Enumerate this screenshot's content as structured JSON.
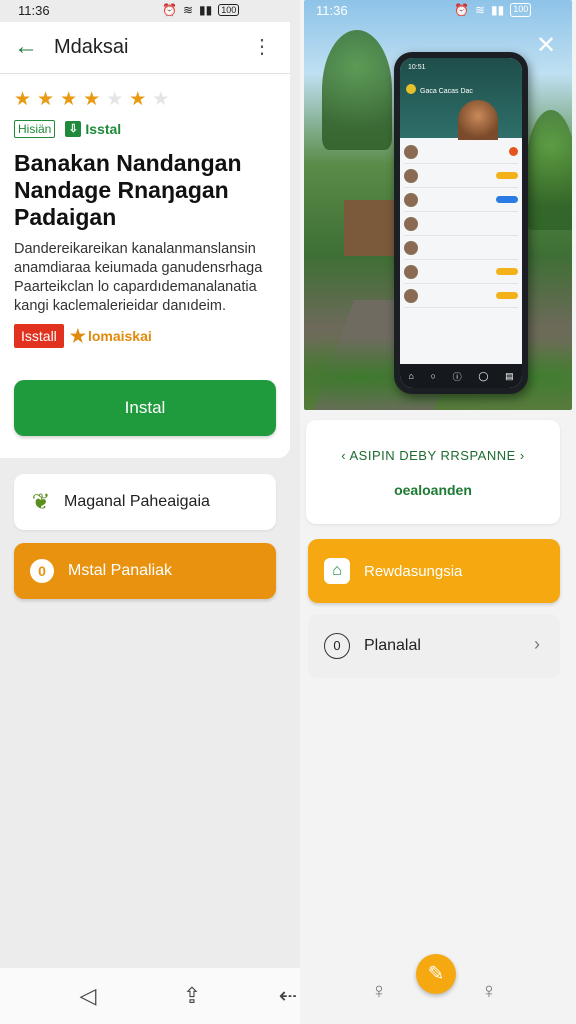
{
  "status_bar": {
    "time": "11:36",
    "battery": "100"
  },
  "left": {
    "appbar": {
      "title": "Mdaksai"
    },
    "rating": {
      "filled": [
        true,
        true,
        true,
        true,
        false,
        true,
        false
      ]
    },
    "tags": {
      "outline": "Hisiän",
      "install": "Isstal"
    },
    "title": "Banakan Nandangan Nandage Rnaŋagan Padaigan",
    "description": "Dandereikareikan kanalanmanslansin anamdiaraa keiumada ganudensrhaga Paarteikclan lo capardıdemanalanatia kangi kaclemalerieidar danıdeim.",
    "badges": {
      "red": "Isstall",
      "orange": "lomaiskai"
    },
    "install_button": "Instal",
    "row_white": "Maganal Paheaigaia",
    "row_orange": "Mstal Panaliak"
  },
  "right": {
    "status_bar": {
      "time": "11:36"
    },
    "phone": {
      "time": "10:51",
      "header": "Gaca Cacas Dac"
    },
    "info_card": {
      "heading": "ASIPIN DEBY RRSPANNE",
      "subtitle": "oealoanden"
    },
    "reward_button": "Rewdasungsia",
    "plan_row": "Planalal"
  },
  "colors": {
    "accent_green": "#1f9a3c",
    "accent_orange": "#e8920f",
    "accent_amber": "#f5a80f",
    "badge_red": "#e0321f"
  }
}
